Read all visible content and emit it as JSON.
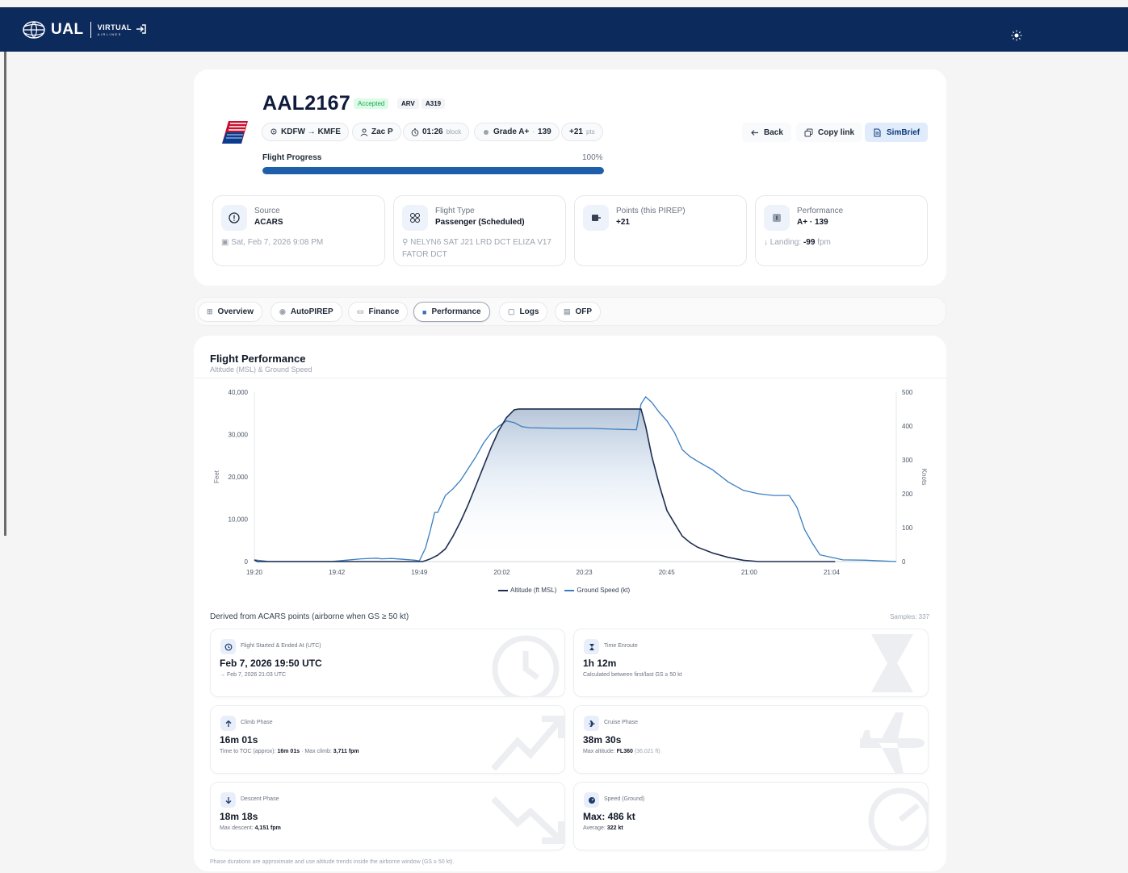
{
  "brand": {
    "name": "UAL",
    "sub_top": "VIRTUAL",
    "sub_bottom": "AIRLINES"
  },
  "flight": {
    "callsign": "AAL2167",
    "status": "Accepted",
    "tags": [
      "ARV",
      "A319"
    ],
    "route": "KDFW → KMFE",
    "pilot": "Zac P",
    "block_time": "01:26",
    "block_label": "block",
    "grade": "Grade A+",
    "grade_sep": "·",
    "grade_score": "139",
    "points": "+21",
    "points_unit": "pts",
    "progress_label": "Flight Progress",
    "progress_text": "100%",
    "progress": 1.0
  },
  "actions": {
    "back": "Back",
    "copy": "Copy link",
    "simbrief": "SimBrief"
  },
  "info": {
    "source": {
      "label": "Source",
      "value": "ACARS",
      "sub": "Sat, Feb 7, 2026 9:08 PM"
    },
    "type": {
      "label": "Flight Type",
      "value": "Passenger (Scheduled)",
      "sub": "NELYN6 SAT J21 LRD DCT ELIZA V17 FATOR DCT"
    },
    "points": {
      "label": "Points (this PIREP)",
      "value": "+21"
    },
    "performance": {
      "label": "Performance",
      "value": "A+ · 139",
      "sub_label": "Landing:",
      "sub_value": "-99",
      "sub_unit": "fpm"
    }
  },
  "tabs": [
    "Overview",
    "AutoPIREP",
    "Finance",
    "Performance",
    "Logs",
    "OFP"
  ],
  "active_tab": "Performance",
  "performance": {
    "title": "Flight Performance",
    "subtitle": "Altitude (MSL) & Ground Speed",
    "derived": "Derived from ACARS points (airborne when GS ≥ 50 kt)",
    "samples": "Samples: 337",
    "legend_alt": "Altitude (ft MSL)",
    "legend_gs": "Ground Speed (kt)",
    "footnote": "Phase durations are approximate and use altitude trends inside the airborne window (GS ≥ 50 kt)."
  },
  "stats": {
    "times": {
      "label": "Flight Started & Ended At (UTC)",
      "value": "Feb 7, 2026 19:50 UTC",
      "detail": "→ Feb 7, 2026 21:03 UTC"
    },
    "enroute": {
      "label": "Time Enroute",
      "value": "1h 12m",
      "detail": "Calculated between first/last GS ≥ 50 kt"
    },
    "climb": {
      "label": "Climb Phase",
      "value": "16m 01s",
      "d1": "Time to TOC (approx):",
      "d2": "16m 01s",
      "d3": "· Max climb:",
      "d4": "3,711 fpm"
    },
    "cruise": {
      "label": "Cruise Phase",
      "value": "38m 30s",
      "d1": "Max altitude:",
      "d2": "FL360",
      "d3": "(36,021 ft)"
    },
    "descent": {
      "label": "Descent Phase",
      "value": "18m 18s",
      "d1": "Max descent:",
      "d2": "4,151 fpm"
    },
    "speed": {
      "label": "Speed (Ground)",
      "value": "Max: 486 kt",
      "d1": "Average:",
      "d2": "322 kt"
    }
  },
  "colors": {
    "navy": "#0d2a5c",
    "altitude": "#1e2d4f",
    "speed": "#3a7ec0",
    "progress": "#1d5fa8"
  },
  "chart_data": {
    "type": "line",
    "title": "Flight Performance",
    "subtitle": "Altitude (MSL) & Ground Speed",
    "x_ticks": [
      "19:20",
      "19:42",
      "19:49",
      "20:02",
      "20:23",
      "20:45",
      "21:00",
      "21:04"
    ],
    "ylabel_left": "Feet",
    "ylabel_right": "Knots",
    "ylim_left": [
      0,
      40000
    ],
    "ylim_right": [
      0,
      500
    ],
    "yticks_left": [
      "0",
      "10,000",
      "20,000",
      "30,000",
      "40,000"
    ],
    "yticks_right": [
      "0",
      "100",
      "200",
      "300",
      "400",
      "500"
    ],
    "legend": "bottom",
    "grid": false,
    "series": [
      {
        "name": "Altitude (ft MSL)",
        "axis": "left",
        "points": [
          [
            0,
            400
          ],
          [
            0.2,
            0
          ],
          [
            2,
            0
          ],
          [
            3,
            0
          ],
          [
            5,
            0
          ],
          [
            7,
            0
          ],
          [
            9,
            0
          ],
          [
            10.5,
            0
          ],
          [
            11,
            0
          ],
          [
            11.2,
            200
          ],
          [
            11.5,
            600
          ],
          [
            12,
            1500
          ],
          [
            12.5,
            3000
          ],
          [
            13,
            6000
          ],
          [
            13.5,
            9500
          ],
          [
            14,
            13500
          ],
          [
            14.5,
            18000
          ],
          [
            15,
            22500
          ],
          [
            15.5,
            27000
          ],
          [
            16,
            31000
          ],
          [
            16.5,
            34000
          ],
          [
            17,
            35800
          ],
          [
            17.3,
            36021
          ],
          [
            18,
            36021
          ],
          [
            20,
            36021
          ],
          [
            22,
            36021
          ],
          [
            24,
            36021
          ],
          [
            25,
            36021
          ],
          [
            25.3,
            36000
          ],
          [
            25.6,
            32000
          ],
          [
            26,
            25000
          ],
          [
            26.5,
            18000
          ],
          [
            27,
            12000
          ],
          [
            27.5,
            9000
          ],
          [
            28,
            6000
          ],
          [
            28.5,
            4500
          ],
          [
            29,
            3400
          ],
          [
            30,
            2000
          ],
          [
            31,
            1000
          ],
          [
            32,
            300
          ],
          [
            33,
            0
          ],
          [
            34,
            0
          ],
          [
            35,
            0
          ],
          [
            36,
            0
          ],
          [
            37,
            0
          ],
          [
            38,
            0
          ]
        ]
      },
      {
        "name": "Ground Speed (kt)",
        "axis": "right",
        "points": [
          [
            0,
            5
          ],
          [
            1,
            0
          ],
          [
            2,
            0
          ],
          [
            3,
            0
          ],
          [
            4,
            0
          ],
          [
            5,
            0
          ],
          [
            5.5,
            2
          ],
          [
            6,
            4
          ],
          [
            7,
            8
          ],
          [
            8,
            10
          ],
          [
            8.3,
            8
          ],
          [
            9,
            9
          ],
          [
            10.5,
            4
          ],
          [
            10.8,
            2
          ],
          [
            11.2,
            40
          ],
          [
            11.5,
            90
          ],
          [
            11.8,
            145
          ],
          [
            12,
            145
          ],
          [
            12.5,
            195
          ],
          [
            13,
            215
          ],
          [
            13.5,
            240
          ],
          [
            14,
            275
          ],
          [
            14.5,
            310
          ],
          [
            15,
            350
          ],
          [
            15.5,
            380
          ],
          [
            16,
            400
          ],
          [
            16.5,
            415
          ],
          [
            17,
            410
          ],
          [
            17.5,
            398
          ],
          [
            18,
            395
          ],
          [
            20,
            393
          ],
          [
            22,
            393
          ],
          [
            24,
            390
          ],
          [
            25,
            389
          ],
          [
            25.3,
            465
          ],
          [
            25.6,
            486
          ],
          [
            26,
            470
          ],
          [
            26.5,
            440
          ],
          [
            27,
            415
          ],
          [
            27.5,
            380
          ],
          [
            28,
            330
          ],
          [
            28.5,
            310
          ],
          [
            29,
            296
          ],
          [
            30,
            270
          ],
          [
            31,
            235
          ],
          [
            32,
            210
          ],
          [
            33,
            200
          ],
          [
            34,
            195
          ],
          [
            35,
            195
          ],
          [
            35.5,
            160
          ],
          [
            36,
            95
          ],
          [
            36.5,
            55
          ],
          [
            37,
            20
          ],
          [
            38,
            10
          ],
          [
            38.5,
            5
          ],
          [
            40,
            4
          ],
          [
            41,
            2
          ],
          [
            42,
            0
          ]
        ]
      }
    ]
  }
}
